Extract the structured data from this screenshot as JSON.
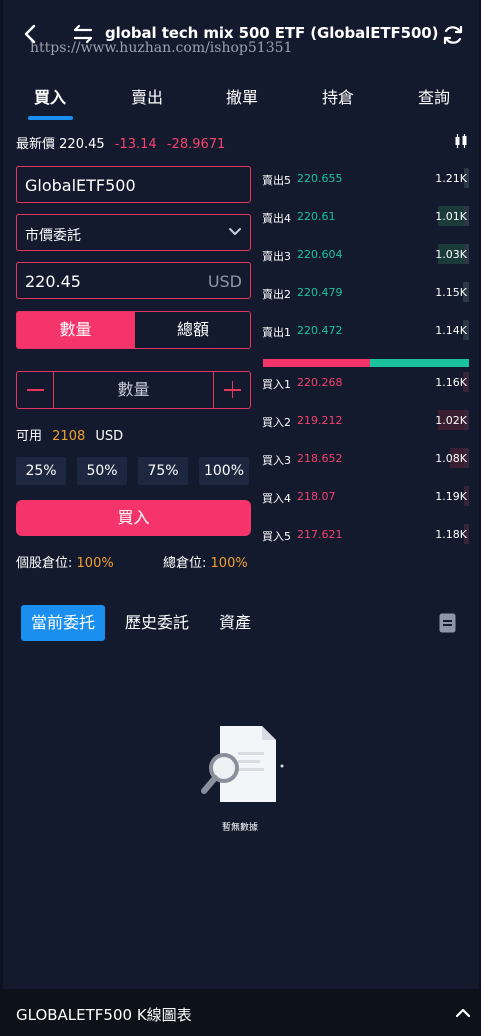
{
  "header": {
    "title": "global tech mix 500 ETF (GlobalETF500)",
    "watermark": "https://www.huzhan.com/ishop51351"
  },
  "tabs": [
    {
      "label": "買入",
      "active": true
    },
    {
      "label": "賣出",
      "active": false
    },
    {
      "label": "撤單",
      "active": false
    },
    {
      "label": "持倉",
      "active": false
    },
    {
      "label": "查詢",
      "active": false
    }
  ],
  "price": {
    "label": "最新價",
    "last": "220.45",
    "change": "-13.14",
    "change_pct": "-28.9671"
  },
  "form": {
    "symbol": "GlobalETF500",
    "order_type": "市價委託",
    "price_value": "220.45",
    "price_unit": "USD",
    "mode_quantity": "數量",
    "mode_amount": "總額",
    "qty_placeholder": "數量",
    "available_label": "可用",
    "available_value": "2108",
    "available_unit": "USD",
    "percents": [
      "25%",
      "50%",
      "75%",
      "100%"
    ],
    "buy_button": "買入",
    "single_position_label": "個股倉位:",
    "single_position_value": "100%",
    "total_position_label": "總倉位:",
    "total_position_value": "100%"
  },
  "orderbook": {
    "asks": [
      {
        "label": "賣出5",
        "price": "220.655",
        "volume": "1.21K",
        "depth": 0.0
      },
      {
        "label": "賣出4",
        "price": "220.61",
        "volume": "1.01K",
        "depth": 0.15
      },
      {
        "label": "賣出3",
        "price": "220.604",
        "volume": "1.03K",
        "depth": 0.15
      },
      {
        "label": "賣出2",
        "price": "220.479",
        "volume": "1.15K",
        "depth": 0.03
      },
      {
        "label": "賣出1",
        "price": "220.472",
        "volume": "1.14K",
        "depth": 0.03
      }
    ],
    "bids": [
      {
        "label": "買入1",
        "price": "220.268",
        "volume": "1.16K",
        "depth": 0.03
      },
      {
        "label": "買入2",
        "price": "219.212",
        "volume": "1.02K",
        "depth": 0.15
      },
      {
        "label": "買入3",
        "price": "218.652",
        "volume": "1.08K",
        "depth": 0.09
      },
      {
        "label": "買入4",
        "price": "218.07",
        "volume": "1.19K",
        "depth": 0.0
      },
      {
        "label": "買入5",
        "price": "217.621",
        "volume": "1.18K",
        "depth": 0.0
      }
    ],
    "buy_ratio": 0.52
  },
  "orders_tabs": [
    {
      "label": "當前委托",
      "active": true
    },
    {
      "label": "歷史委託",
      "active": false
    },
    {
      "label": "資產",
      "active": false
    }
  ],
  "empty_text": "暫無數據",
  "footer": {
    "label": "GLOBALETF500  K線圖表"
  },
  "colors": {
    "background": "#131a2e",
    "accent_red": "#f5346b",
    "accent_green": "#19c39e",
    "accent_blue": "#1a8ff0",
    "orange": "#f0a030"
  }
}
